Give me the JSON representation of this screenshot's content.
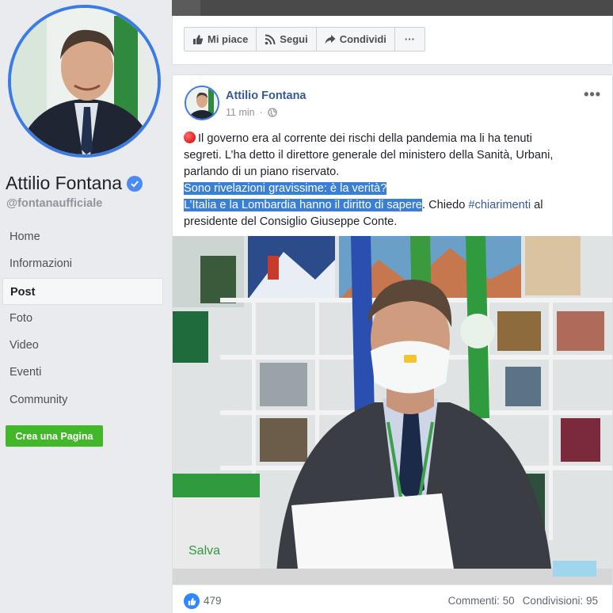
{
  "sidebar": {
    "page_name": "Attilio Fontana",
    "handle": "@fontanaufficiale",
    "nav_items": [
      {
        "label": "Home"
      },
      {
        "label": "Informazioni"
      },
      {
        "label": "Post"
      },
      {
        "label": "Foto"
      },
      {
        "label": "Video"
      },
      {
        "label": "Eventi"
      },
      {
        "label": "Community"
      }
    ],
    "create_page_label": "Crea una Pagina"
  },
  "action_bar": {
    "like_label": "Mi piace",
    "follow_label": "Segui",
    "share_label": "Condividi",
    "more_label": "···"
  },
  "post": {
    "author": "Attilio Fontana",
    "time": "11 min",
    "text_line1": "Il governo era al corrente dei rischi della pandemia ma li ha tenuti",
    "text_line2": "segreti. L’ha detto il direttore generale del ministero della Sanità, Urbani,",
    "text_line3": "parlando di un piano riservato.",
    "text_line4": "Sono rivelazioni gravissime: è la verità?",
    "text_line5_selected": "L’Italia e la Lombardia hanno il diritto di sapere",
    "text_line5_rest": ". Chiedo ",
    "hashtag": "#chiarimenti",
    "text_line5_end": " al",
    "text_line6": "presidente del Consiglio Giuseppe Conte.",
    "photo_sign_text": "Salva",
    "menu_label": "•••",
    "likes": "479",
    "comments": "Commenti: 50",
    "shares": "Condivisioni: 95"
  },
  "colors": {
    "link_blue": "#365899",
    "selection_blue": "#3a7fd6",
    "green_button": "#42b72a",
    "avatar_ring": "#3b7be6",
    "like_blue": "#2d88ff"
  }
}
